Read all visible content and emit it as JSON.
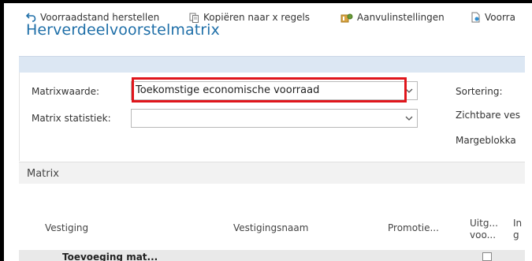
{
  "page": {
    "title": "Herverdeelvoorstelmatrix"
  },
  "options": {
    "matrix_value_label": "Matrixwaarde:",
    "matrix_value": "Toekomstige economische voorraad",
    "matrix_stat_label": "Matrix statistiek:",
    "matrix_stat_value": "",
    "sort_label": "Sortering:",
    "visible_label": "Zichtbare ves",
    "margin_label": "Margeblokka"
  },
  "matrix": {
    "section_label": "Matrix",
    "toolbar": [
      {
        "label": "Voorraadstand herstellen",
        "icon": "undo-icon"
      },
      {
        "label": "Kopiëren naar x regels",
        "icon": "copy-icon"
      },
      {
        "label": "Aanvulinstellingen",
        "icon": "settings-icon"
      },
      {
        "label": "Voorra",
        "icon": "document-icon"
      }
    ],
    "columns": [
      "Vestiging",
      "Vestigingsnaam",
      "Promotie...",
      "Uitg... voo...",
      "In g"
    ],
    "first_row_text": "Toevoeging mat..."
  },
  "colors": {
    "title": "#1f6fa8",
    "highlight": "#e0161c",
    "band": "#dce7f3"
  }
}
